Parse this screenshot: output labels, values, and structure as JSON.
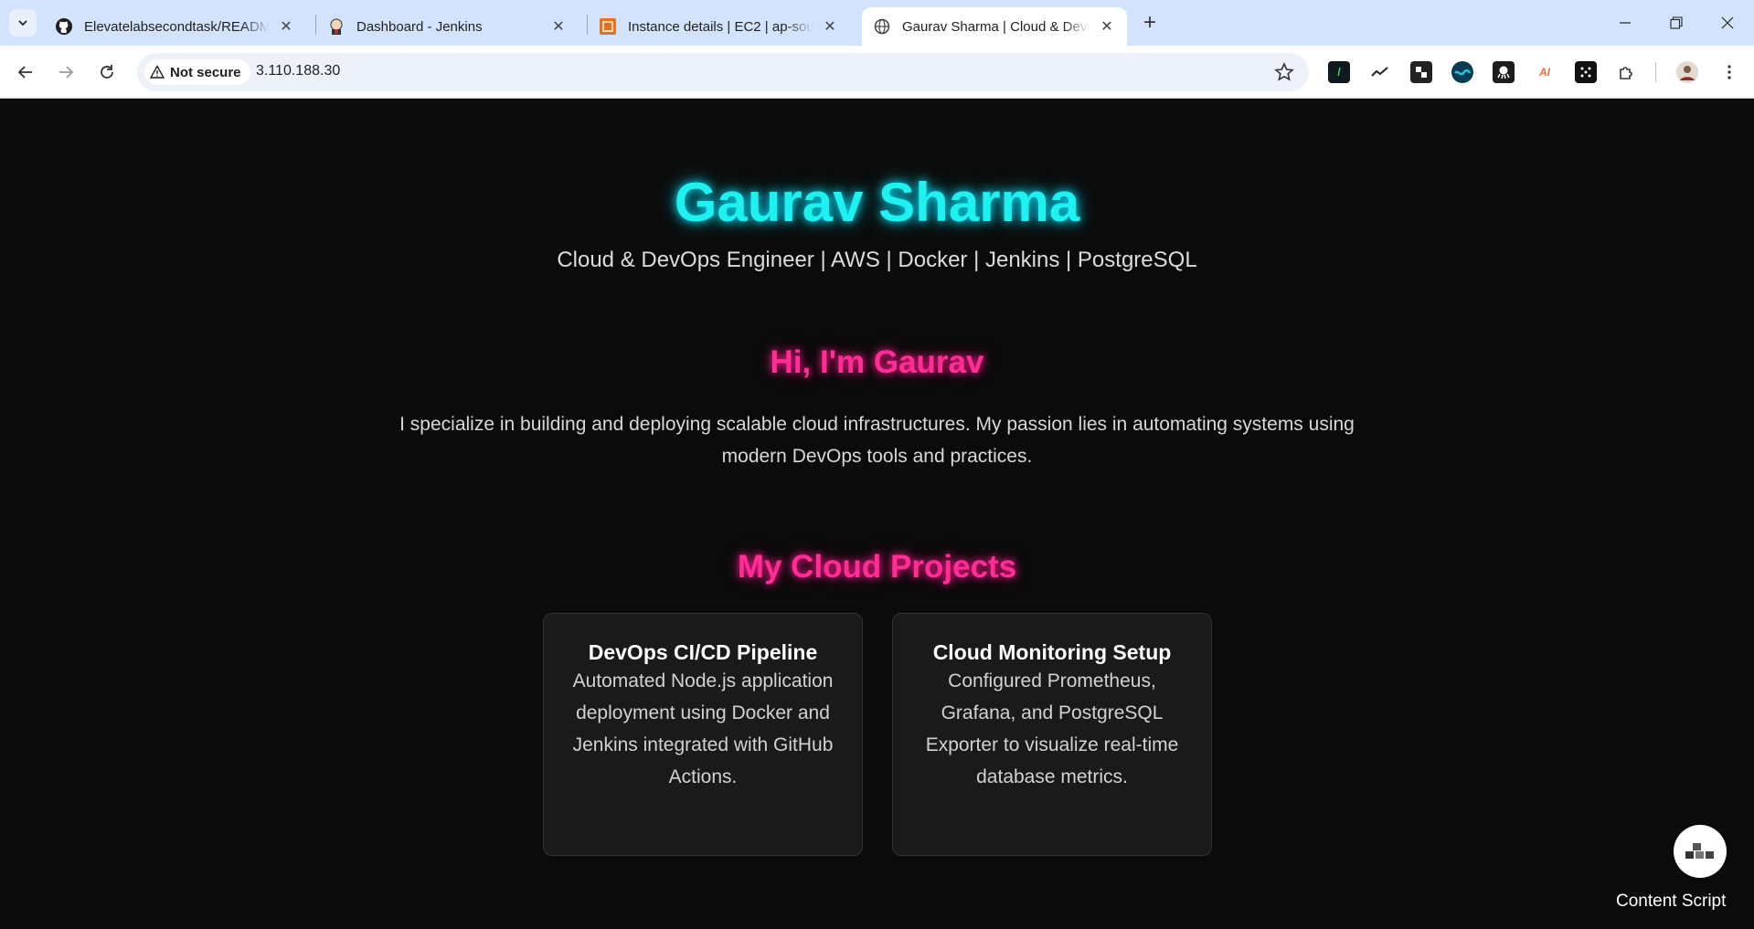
{
  "browser": {
    "tabs": [
      {
        "title": "Elevatelabsecondtask/README.",
        "icon": "github-icon",
        "active": false
      },
      {
        "title": "Dashboard - Jenkins",
        "icon": "jenkins-icon",
        "active": false
      },
      {
        "title": "Instance details | EC2 | ap-south",
        "icon": "aws-ec2-icon",
        "active": false
      },
      {
        "title": "Gaurav Sharma | Cloud & DevO",
        "icon": "globe-icon",
        "active": true
      }
    ],
    "security_chip": "Not secure",
    "url": "3.110.188.30"
  },
  "hero": {
    "name": "Gaurav Sharma",
    "tagline": "Cloud & DevOps Engineer | AWS | Docker | Jenkins | PostgreSQL"
  },
  "about": {
    "heading": "Hi, I'm Gaurav",
    "text": "I specialize in building and deploying scalable cloud infrastructures. My passion lies in automating systems using modern DevOps tools and practices."
  },
  "projects": {
    "heading": "My Cloud Projects",
    "items": [
      {
        "title": "DevOps CI/CD Pipeline",
        "description": "Automated Node.js application deployment using Docker and Jenkins integrated with GitHub Actions."
      },
      {
        "title": "Cloud Monitoring Setup",
        "description": "Configured Prometheus, Grafana, and PostgreSQL Exporter to visualize real-time database metrics."
      }
    ]
  },
  "widget": {
    "label": "Content Script"
  },
  "colors": {
    "title_glow": "#1ff0f0",
    "heading_pink": "#ff2d95",
    "background": "#0b0b0b",
    "card": "#1a1a1a"
  }
}
